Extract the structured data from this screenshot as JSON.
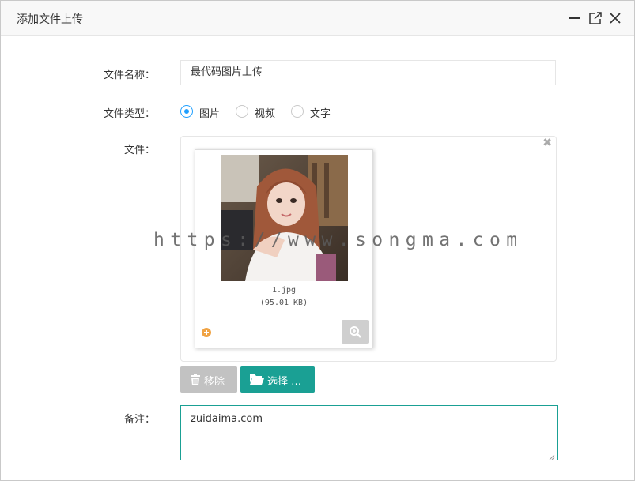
{
  "dialog": {
    "title": "添加文件上传"
  },
  "form": {
    "name_label": "文件名称：",
    "name_value": "最代码图片上传",
    "type_label": "文件类型：",
    "type_options": [
      "图片",
      "视频",
      "文字"
    ],
    "type_selected": "图片",
    "file_label": "文件：",
    "note_label": "备注：",
    "note_value": "zuidaima.com"
  },
  "file_preview": {
    "filename": "1.jpg",
    "filesize": "(95.01 KB)"
  },
  "buttons": {
    "remove_label": "移除",
    "select_label": "选择 …"
  },
  "watermark": "https://www.songma.com",
  "colors": {
    "accent": "#1aa094",
    "radio_checked": "#1e9fff",
    "remove_button": "#c2c2c2",
    "upload_state": "#f0a344"
  },
  "icons": {
    "titlebar": [
      "minimize-icon",
      "maximize-icon",
      "close-icon"
    ],
    "file_clear": "close-icon",
    "upload_state": "plus-circle-icon",
    "zoom": "zoom-in-icon",
    "remove": "trash-icon",
    "select": "folder-open-icon"
  }
}
